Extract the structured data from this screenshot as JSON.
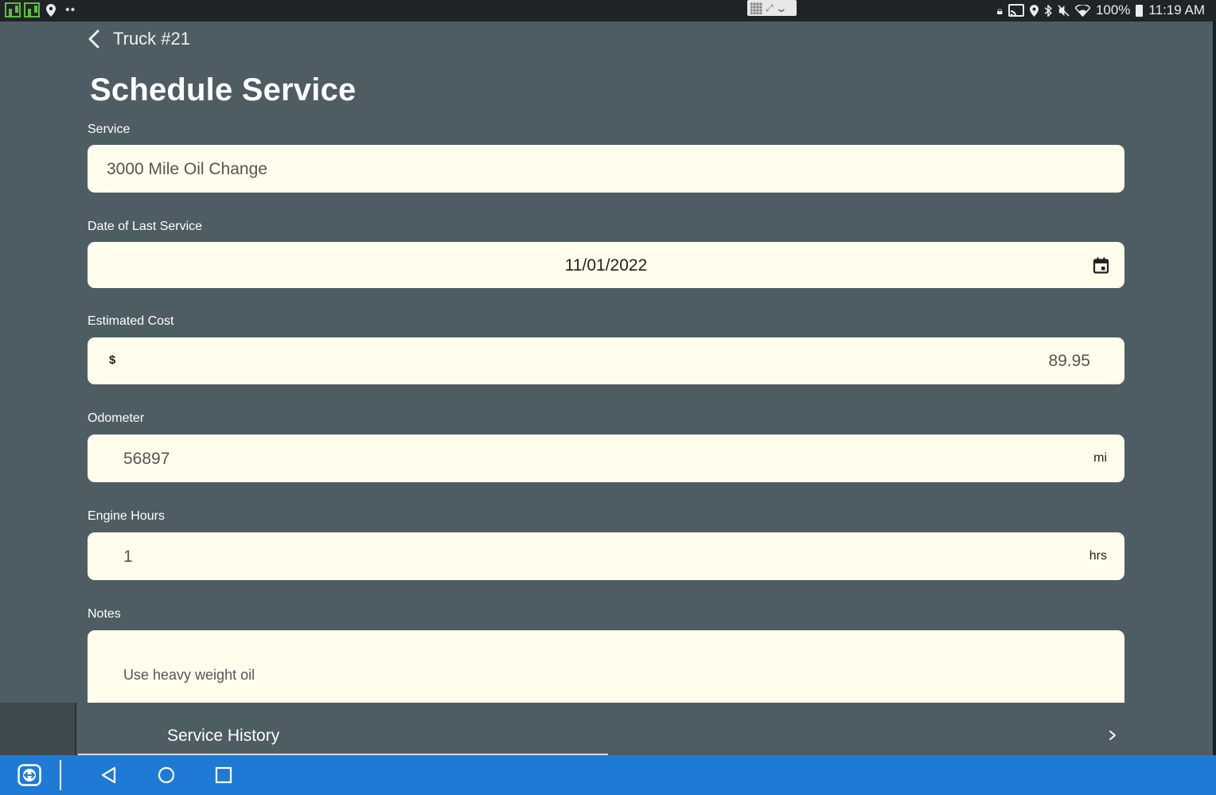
{
  "status_bar": {
    "battery": "100%",
    "time": "11:19 AM",
    "dots": "••",
    "icons": [
      "app-icon",
      "app-icon",
      "location-icon",
      "lock-icon",
      "cast-icon",
      "location-icon",
      "bluetooth-icon",
      "mute-icon",
      "wifi-icon",
      "battery-icon"
    ]
  },
  "header": {
    "back_label": "Truck #21",
    "title": "Schedule Service"
  },
  "form": {
    "service": {
      "label": "Service",
      "value": "3000 Mile Oil Change"
    },
    "last_service": {
      "label": "Date of Last Service",
      "value": "11/01/2022"
    },
    "cost": {
      "label": "Estimated Cost",
      "currency": "$",
      "value": "89.95"
    },
    "odometer": {
      "label": "Odometer",
      "value": "56897",
      "unit": "mi"
    },
    "engine_hours": {
      "label": "Engine Hours",
      "value": "1",
      "unit": "hrs"
    },
    "notes": {
      "label": "Notes",
      "value": "Use heavy weight oil"
    }
  },
  "history": {
    "label": "Service History"
  },
  "colors": {
    "background": "#4d5d63",
    "field": "#fffdec",
    "navbar": "#1f7ad6",
    "statusbar": "#1f2426"
  }
}
